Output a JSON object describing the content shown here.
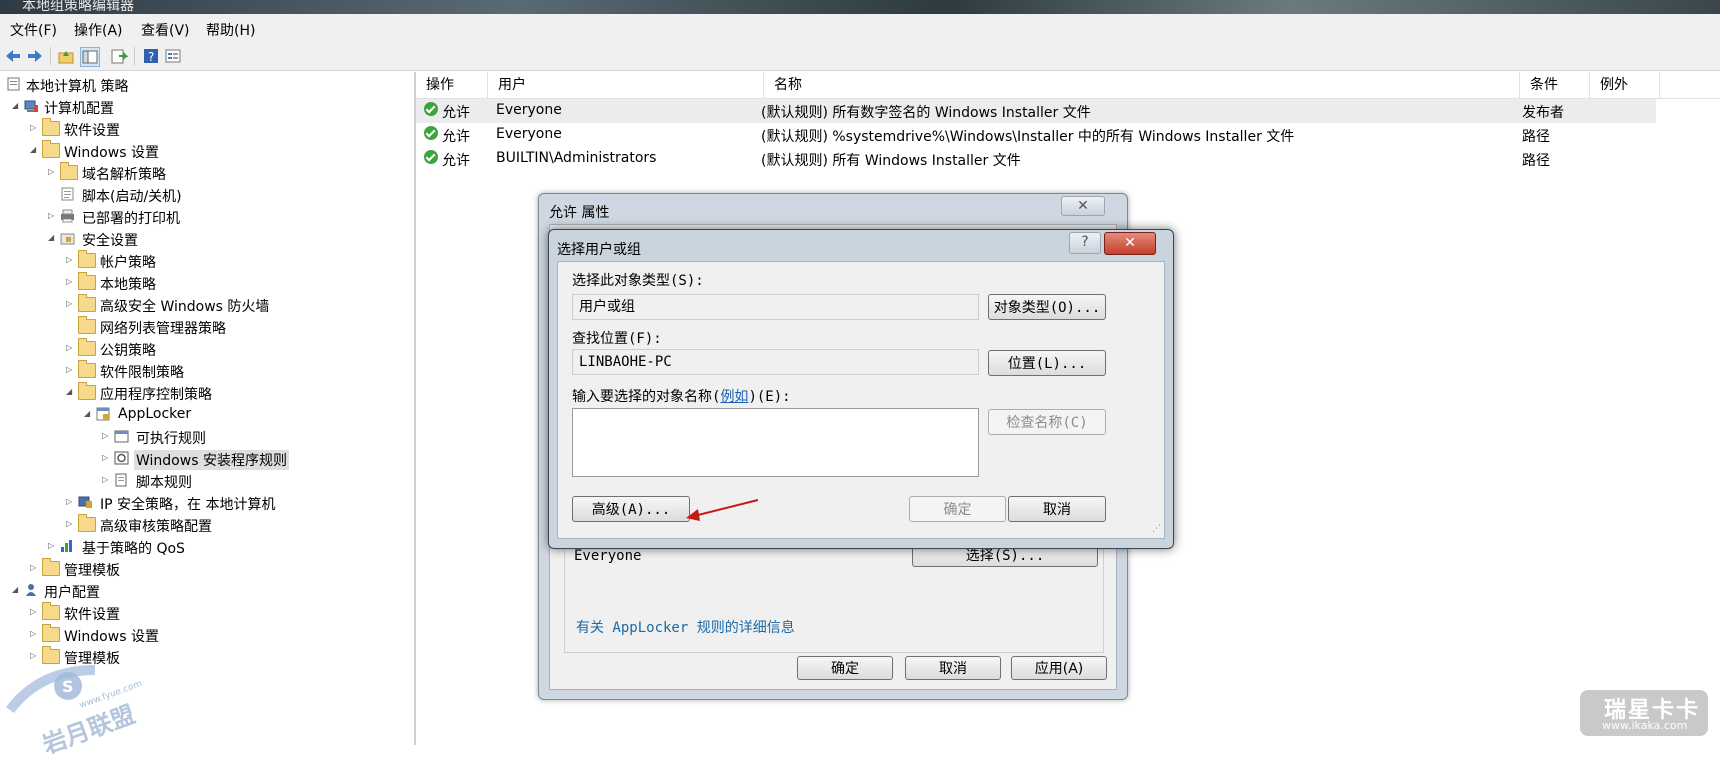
{
  "window": {
    "title": "本地组策略编辑器"
  },
  "menubar": {
    "items": [
      "文件(F)",
      "操作(A)",
      "查看(V)",
      "帮助(H)"
    ]
  },
  "toolbar": {
    "icons": [
      "back-icon",
      "forward-icon",
      "up-folder-icon",
      "show-hide-tree-icon",
      "export-list-icon",
      "help-icon",
      "properties-icon"
    ]
  },
  "tree": {
    "root": "本地计算机 策略",
    "computer_config": "计算机配置",
    "software_settings": "软件设置",
    "windows_settings": "Windows 设置",
    "dns_policy": "域名解析策略",
    "scripts": "脚本(启动/关机)",
    "printers": "已部署的打印机",
    "security_settings": "安全设置",
    "account_policies": "帐户策略",
    "local_policies": "本地策略",
    "firewall": "高级安全 Windows 防火墙",
    "network_list": "网络列表管理器策略",
    "public_key": "公钥策略",
    "software_restriction": "软件限制策略",
    "app_control": "应用程序控制策略",
    "applocker": "AppLocker",
    "exe_rules": "可执行规则",
    "installer_rules": "Windows 安装程序规则",
    "script_rules": "脚本规则",
    "ip_security": "IP 安全策略，在 本地计算机",
    "audit_policy": "高级审核策略配置",
    "qos": "基于策略的 QoS",
    "admin_templates": "管理模板",
    "user_config": "用户配置",
    "user_software": "软件设置",
    "user_windows": "Windows 设置",
    "user_admin_templates": "管理模板"
  },
  "list": {
    "headers": [
      "操作",
      "用户",
      "名称",
      "条件",
      "例外"
    ],
    "rows": [
      {
        "action": "允许",
        "user": "Everyone",
        "name": "(默认规则) 所有数字签名的 Windows Installer 文件",
        "condition": "发布者"
      },
      {
        "action": "允许",
        "user": "Everyone",
        "name": "(默认规则) %systemdrive%\\Windows\\Installer 中的所有 Windows Installer 文件",
        "condition": "路径"
      },
      {
        "action": "允许",
        "user": "BUILTIN\\Administrators",
        "name": "(默认规则) 所有 Windows Installer 文件",
        "condition": "路径"
      }
    ]
  },
  "props_dialog": {
    "title": "允许 属性",
    "user_value": "Everyone",
    "select_button": "选择(S)...",
    "more_info_link": "有关 AppLocker 规则的详细信息",
    "ok": "确定",
    "cancel": "取消",
    "apply": "应用(A)"
  },
  "select_dialog": {
    "title": "选择用户或组",
    "object_type_label": "选择此对象类型(S):",
    "object_type_value": "用户或组",
    "object_type_button": "对象类型(O)...",
    "location_label": "查找位置(F):",
    "location_value": "LINBAOHE-PC",
    "location_button": "位置(L)...",
    "names_label_pre": "输入要选择的对象名称(",
    "names_label_link": "例如",
    "names_label_post": ")(E):",
    "names_value": "",
    "check_names_button": "检查名称(C)",
    "advanced_button": "高级(A)...",
    "ok": "确定",
    "cancel": "取消",
    "help_glyph": "?"
  },
  "watermarks": {
    "left_main": "岩月联盟",
    "left_sub": "www.fyue.com",
    "right_main": "瑞星卡卡",
    "right_sub": "www.ikaka.com"
  }
}
